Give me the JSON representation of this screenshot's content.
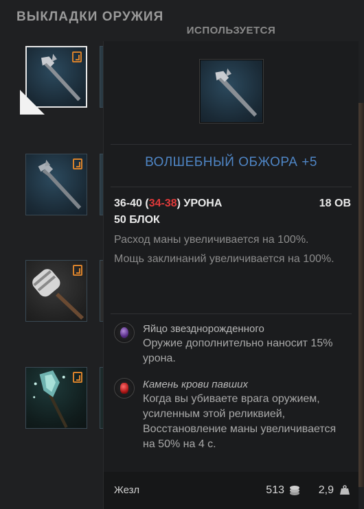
{
  "screen": {
    "title": "ВЫКЛАДКИ ОРУЖИЯ"
  },
  "loadout_slots": [
    {
      "item": "staff-icon",
      "selected": true
    },
    {
      "item": "staff-icon",
      "selected": false
    },
    {
      "item": "club-icon",
      "selected": false
    },
    {
      "item": "crystal-staff-icon",
      "selected": false
    }
  ],
  "tooltip": {
    "header": "ИСПОЛЬЗУЕТСЯ",
    "item_name": "ВОЛШЕБНЫЙ ОБЖОРА +5",
    "damage_base": "36-40 (",
    "damage_low": "34",
    "damage_dash": "-",
    "damage_high": "38",
    "damage_suffix": ") УРОНА",
    "score": "18 ОВ",
    "block": "50 БЛОК",
    "affixes": [
      "Расход маны увеличивается на 100%.",
      "Мощь заклинаний увеличивается на 100%."
    ],
    "relics": [
      {
        "icon": "egg-gem-icon",
        "title": "Яйцо звезднорожденного",
        "desc": "Оружие дополнительно наносит 15% урона."
      },
      {
        "icon": "blood-gem-icon",
        "title": "Камень крови павших",
        "desc": "Когда вы убиваете врага оружием, усиленным этой реликвией, Восстановление маны увеличивается на 50% на 4 с."
      }
    ],
    "footer": {
      "type": "Жезл",
      "price": "513",
      "weight": "2,9"
    }
  },
  "colors": {
    "item_name": "#4f86c6",
    "damage_red": "#e03a3a",
    "rank_orange": "#d9822b"
  }
}
